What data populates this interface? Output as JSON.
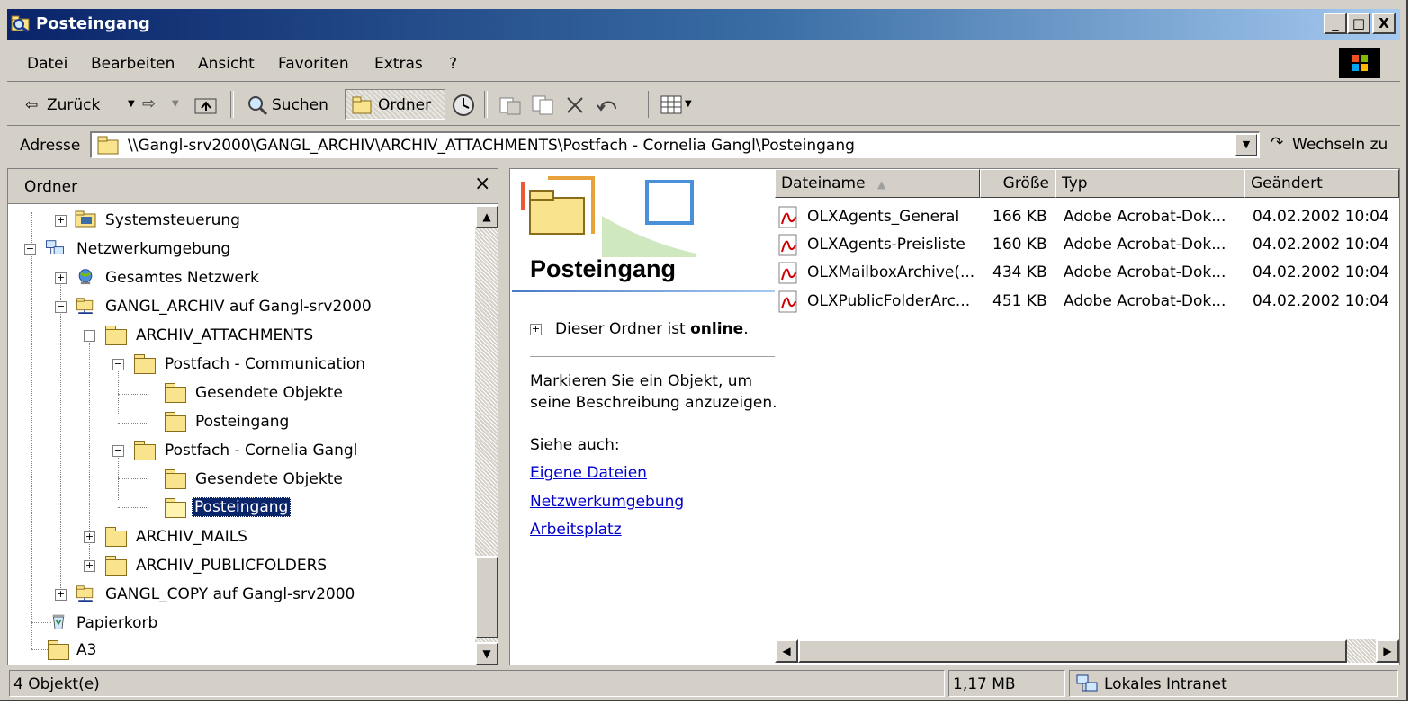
{
  "window": {
    "title": "Posteingang",
    "buttons": {
      "minimize": "_",
      "maximize": "□",
      "close": "X"
    }
  },
  "menu": {
    "items": [
      "Datei",
      "Bearbeiten",
      "Ansicht",
      "Favoriten",
      "Extras",
      "?"
    ]
  },
  "toolbar": {
    "back_label": "Zurück",
    "search_label": "Suchen",
    "folders_label": "Ordner"
  },
  "address": {
    "label": "Adresse",
    "path": "\\\\Gangl-srv2000\\GANGL_ARCHIV\\ARCHIV_ATTACHMENTS\\Postfach - Cornelia Gangl\\Posteingang",
    "go_label": "Wechseln zu"
  },
  "tree": {
    "header": "Ordner",
    "close_glyph": "×",
    "items": [
      {
        "label": "Systemsteuerung",
        "expander": "+"
      },
      {
        "label": "Netzwerkumgebung",
        "expander": "−"
      },
      {
        "label": "Gesamtes Netzwerk",
        "expander": "+"
      },
      {
        "label": "GANGL_ARCHIV auf Gangl-srv2000",
        "expander": "−"
      },
      {
        "label": "ARCHIV_ATTACHMENTS",
        "expander": "−"
      },
      {
        "label": "Postfach - Communication",
        "expander": "−"
      },
      {
        "label": "Gesendete Objekte",
        "expander": ""
      },
      {
        "label": "Posteingang",
        "expander": ""
      },
      {
        "label": "Postfach - Cornelia Gangl",
        "expander": "−"
      },
      {
        "label": "Gesendete Objekte",
        "expander": ""
      },
      {
        "label": "Posteingang",
        "expander": "",
        "selected": true
      },
      {
        "label": "ARCHIV_MAILS",
        "expander": "+"
      },
      {
        "label": "ARCHIV_PUBLICFOLDERS",
        "expander": "+"
      },
      {
        "label": "GANGL_COPY auf Gangl-srv2000",
        "expander": "+"
      },
      {
        "label": "Papierkorb",
        "expander": ""
      },
      {
        "label": "A3",
        "expander": ""
      }
    ]
  },
  "info_panel": {
    "folder_title": "Posteingang",
    "status_prefix": "Dieser Ordner ist ",
    "status_bold": "online",
    "status_suffix": ".",
    "hint_line1": "Markieren Sie ein Objekt, um",
    "hint_line2": "seine Beschreibung anzuzeigen.",
    "see_also": "Siehe auch:",
    "links": [
      "Eigene Dateien",
      "Netzwerkumgebung",
      "Arbeitsplatz"
    ]
  },
  "file_list": {
    "columns": [
      "Dateiname",
      "Größe",
      "Typ",
      "Geändert"
    ],
    "sort_glyph": "▲",
    "rows": [
      {
        "name": "OLXAgents_General",
        "size": "166 KB",
        "type": "Adobe Acrobat-Dok...",
        "modified": "04.02.2002 10:04"
      },
      {
        "name": "OLXAgents-Preisliste",
        "size": "160 KB",
        "type": "Adobe Acrobat-Dok...",
        "modified": "04.02.2002 10:04"
      },
      {
        "name": "OLXMailboxArchive(...",
        "size": "434 KB",
        "type": "Adobe Acrobat-Dok...",
        "modified": "04.02.2002 10:04"
      },
      {
        "name": "OLXPublicFolderArc...",
        "size": "451 KB",
        "type": "Adobe Acrobat-Dok...",
        "modified": "04.02.2002 10:04"
      }
    ]
  },
  "statusbar": {
    "objects": "4 Objekt(e)",
    "size": "1,17 MB",
    "zone": "Lokales Intranet"
  },
  "colors": {
    "titlebar_start": "#0a246a",
    "titlebar_end": "#a6caf0",
    "face": "#d4d0c8",
    "selection": "#0a246a",
    "link": "#0000cc"
  }
}
